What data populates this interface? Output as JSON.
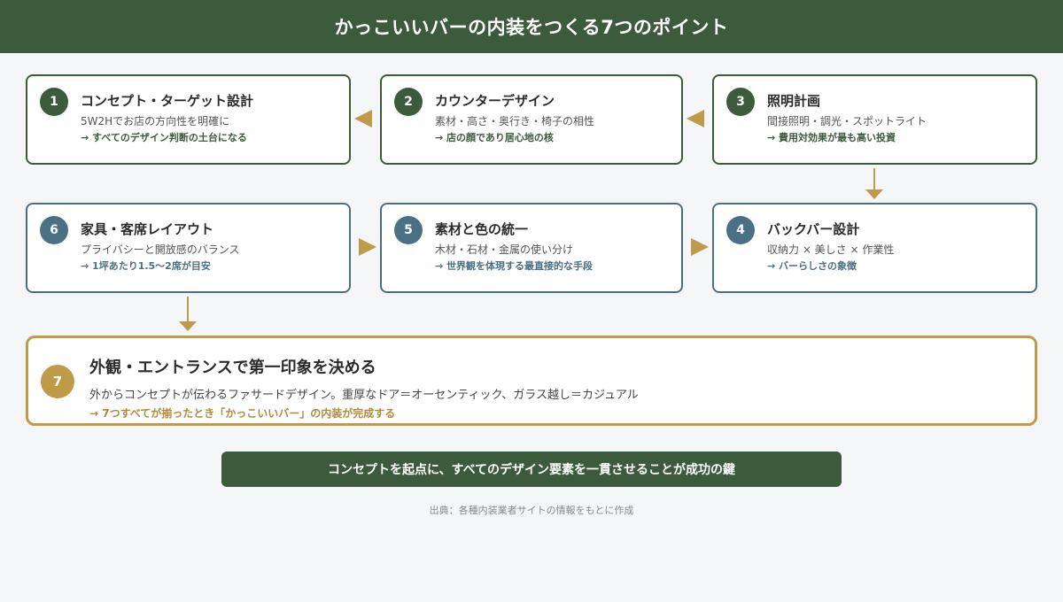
{
  "title": "かっこいいバーの内装をつくる7つのポイント",
  "colors": {
    "green": "#3c5a3c",
    "blue": "#4a7084",
    "gold": "#bf9a48",
    "background": "#f5f6f8"
  },
  "steps": [
    {
      "num": "1",
      "title": "コンセプト・ターゲット設計",
      "desc": "5W2Hでお店の方向性を明確に",
      "note": "→ すべてのデザイン判断の土台になる"
    },
    {
      "num": "2",
      "title": "カウンターデザイン",
      "desc": "素材・高さ・奥行き・椅子の相性",
      "note": "→ 店の顔であり居心地の核"
    },
    {
      "num": "3",
      "title": "照明計画",
      "desc": "間接照明・調光・スポットライト",
      "note": "→ 費用対効果が最も高い投資"
    },
    {
      "num": "4",
      "title": "バックバー設計",
      "desc": "収納力 × 美しさ × 作業性",
      "note": "→ バーらしさの象徴"
    },
    {
      "num": "5",
      "title": "素材と色の統一",
      "desc": "木材・石材・金属の使い分け",
      "note": "→ 世界観を体現する最直接的な手段"
    },
    {
      "num": "6",
      "title": "家具・客席レイアウト",
      "desc": "プライバシーと開放感のバランス",
      "note": "→ 1坪あたり1.5〜2席が目安"
    },
    {
      "num": "7",
      "title": "外観・エントランスで第一印象を決める",
      "desc": "外からコンセプトが伝わるファサードデザイン。重厚なドア＝オーセンティック、ガラス越し＝カジュアル",
      "note": "→ 7つすべてが揃ったとき「かっこいいバー」の内装が完成する"
    }
  ],
  "banner": "コンセプトを起点に、すべてのデザイン要素を一貫させることが成功の鍵",
  "source": "出典：各種内装業者サイトの情報をもとに作成"
}
